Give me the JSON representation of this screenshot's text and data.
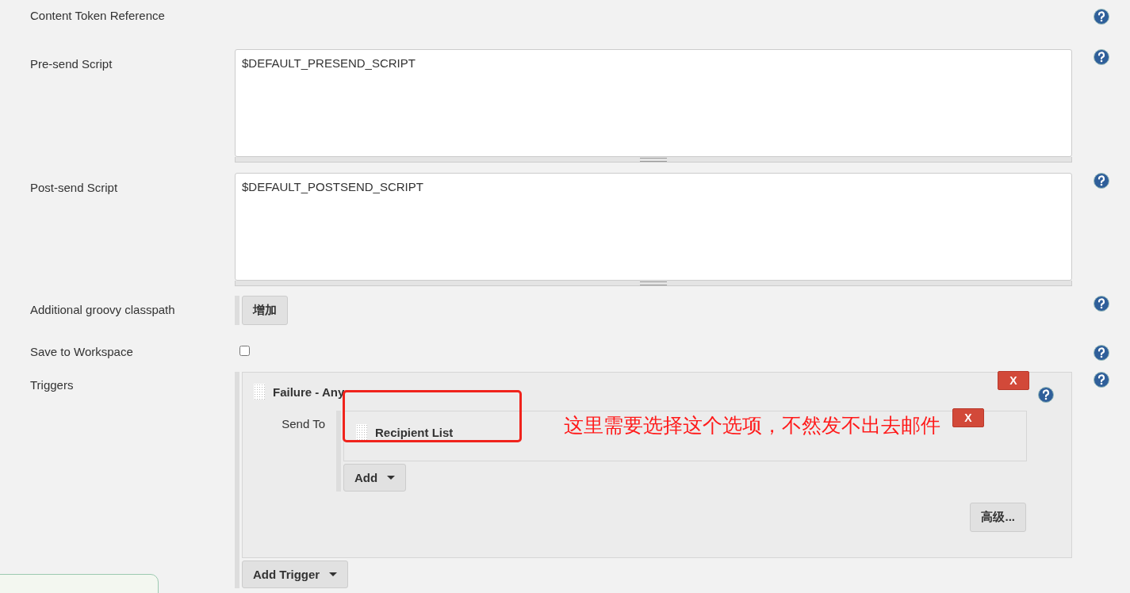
{
  "fields": [
    {
      "kind": "help",
      "label": "Content Token Reference"
    },
    {
      "kind": "textarea",
      "label": "Pre-send Script",
      "value": "$DEFAULT_PRESEND_SCRIPT"
    },
    {
      "kind": "textarea",
      "label": "Post-send Script",
      "value": "$DEFAULT_POSTSEND_SCRIPT"
    },
    {
      "kind": "button",
      "label": "Additional groovy classpath",
      "button": "增加"
    },
    {
      "kind": "checkbox",
      "label": "Save to Workspace",
      "checked": false
    }
  ],
  "triggers": {
    "label": "Triggers",
    "items": [
      {
        "title": "Failure - Any",
        "delete": "X",
        "send_to_label": "Send To",
        "recipients": [
          {
            "title": "Recipient List",
            "delete": "X"
          }
        ],
        "add_button": "Add",
        "advanced_button": "高级..."
      }
    ],
    "add_trigger": "Add Trigger"
  },
  "annotation": {
    "text": "这里需要选择这个选项，不然发不出去邮件"
  }
}
